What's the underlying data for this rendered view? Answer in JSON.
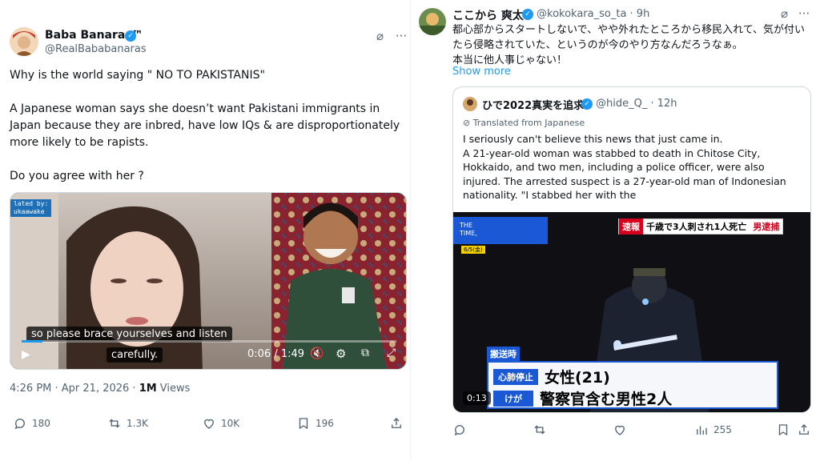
{
  "left_tweet": {
    "author_name": "Baba Banaras™",
    "author_handle": "@RealBababanaras",
    "text_line1": "Why is the world saying \" NO TO PAKISTANIS\"",
    "text_para2": "A Japanese woman says she doesn’t want Pakistani immigrants in Japan because they are inbred, have low IQs & are disproportionately more likely to be rapists.",
    "text_para3": "Do you agree with her ?",
    "video": {
      "overlay_tag_1": "lated by:",
      "overlay_tag_2": "ukaawake",
      "subtitle_line1": "so please brace yourselves and listen",
      "subtitle_line2": "carefully.",
      "time": "0:06 / 1:49",
      "progress": 0.055
    },
    "timestamp": "4:26 PM · Apr 21, 2026 · ",
    "views_count": "1M",
    "views_label": " Views",
    "replies": "180",
    "reposts": "1.3K",
    "likes": "10K",
    "bookmarks": "196"
  },
  "right_tweet": {
    "author_name": "ここから 爽太",
    "author_handle": "@kokokara_so_ta · 9h",
    "text": "都心部からスタートしないで、やや外れたところから移民入れて、気が付いたら侵略されていた、というのが今のやり方なんだろうなぁ。",
    "text2": "本当に他人事じゃない！",
    "show_more": "Show more",
    "quote": {
      "author_name": "ひで2022真実を追求",
      "author_handle": "@hide_Q_ · 12h",
      "translated_label": "Translated from Japanese",
      "text": "I seriously can't believe this news that just came in.\nA 21-year-old woman was stabbed to death in Chitose City, Hokkaido, and two men, including a police officer, were also injured. The arrested suspect is a 27-year-old man of Indonesian nationality. \"I stabbed her with the",
      "video": {
        "logo_line1": "THE",
        "logo_line2": "TIME,",
        "date_tag": "6/5(金)",
        "breaking_label": "速報",
        "headline": "千歳で3人刺され1人死亡",
        "arrest_label": "男逮捕",
        "transport_label": "搬送時",
        "row1_tag": "心肺停止",
        "row1_text": "女性(21)",
        "row2_tag": "けが",
        "row2_text": "警察官含む男性2人",
        "time": "0:13"
      }
    },
    "views": "255"
  }
}
